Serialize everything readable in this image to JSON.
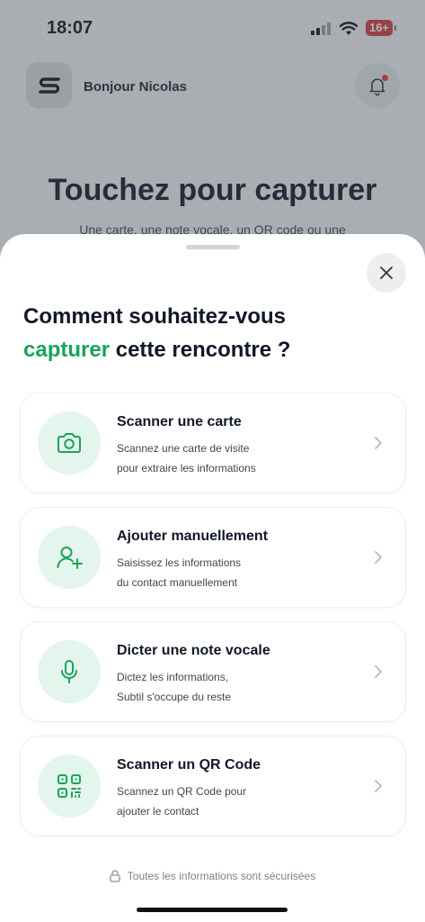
{
  "status": {
    "time": "18:07",
    "battery": "16+"
  },
  "header": {
    "greeting": "Bonjour Nicolas"
  },
  "background": {
    "title": "Touchez pour capturer",
    "subtitle": "Une carte, une note vocale, un QR code ou une"
  },
  "sheet": {
    "heading_line1": "Comment souhaitez-vous",
    "heading_accent": "capturer",
    "heading_rest": " cette rencontre ?",
    "options": [
      {
        "title": "Scanner une carte",
        "desc1": "Scannez une carte de visite",
        "desc2": "pour extraire les informations",
        "icon": "camera-icon"
      },
      {
        "title": "Ajouter manuellement",
        "desc1": "Saisissez les informations",
        "desc2": "du contact manuellement",
        "icon": "user-plus-icon"
      },
      {
        "title": "Dicter une note vocale",
        "desc1": "Dictez les informations,",
        "desc2": "Subtil s'occupe du reste",
        "icon": "microphone-icon"
      },
      {
        "title": "Scanner un QR Code",
        "desc1": "Scannez un QR Code pour",
        "desc2": "ajouter le contact",
        "icon": "qr-code-icon"
      }
    ],
    "secure_note": "Toutes les informations sont sécurisées"
  },
  "colors": {
    "accent": "#1aa45a",
    "icon_bg": "#e3f5ec",
    "text": "#111827"
  }
}
